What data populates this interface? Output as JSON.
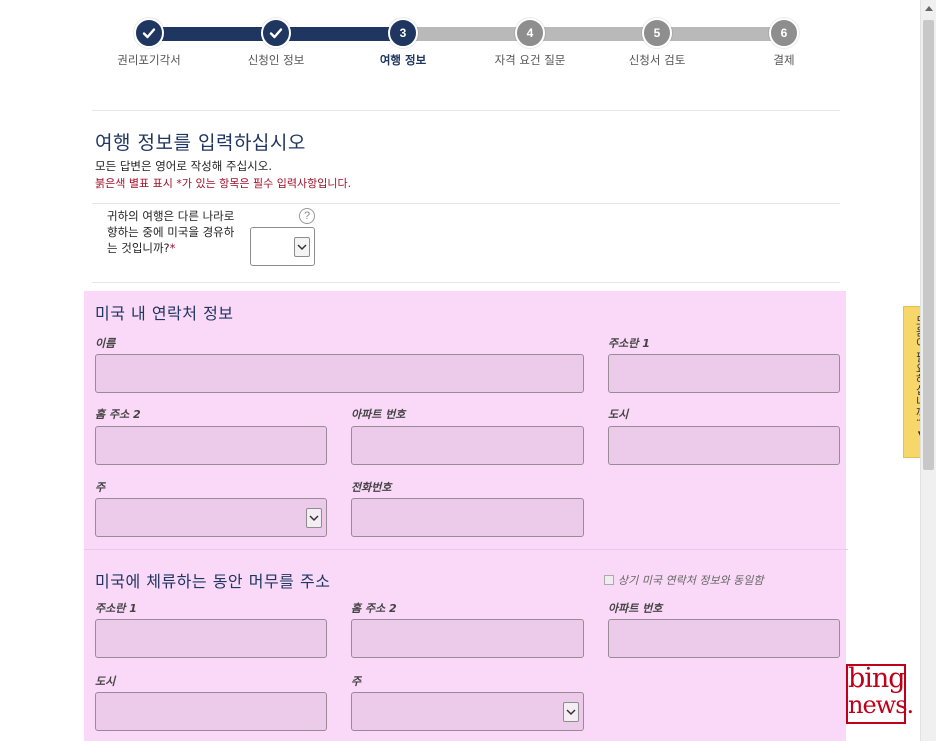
{
  "stepper": {
    "steps": [
      {
        "label": "권리포기각서",
        "number": "1",
        "state": "done"
      },
      {
        "label": "신청인 정보",
        "number": "2",
        "state": "done"
      },
      {
        "label": "여행 정보",
        "number": "3",
        "state": "current"
      },
      {
        "label": "자격 요건 질문",
        "number": "4",
        "state": "todo"
      },
      {
        "label": "신청서 검토",
        "number": "5",
        "state": "todo"
      },
      {
        "label": "결제",
        "number": "6",
        "state": "todo"
      }
    ]
  },
  "header": {
    "title": "여행 정보를 입력하십시오",
    "note": "모든 답변은 영어로 작성해 주십시오.",
    "required_note": "붉은색 별표 표시 *가 있는 항목은 필수 입력사항입니다."
  },
  "transit": {
    "question": "귀하의 여행은 다른 나라로 향하는 중에 미국을 경유하는 것입니까?",
    "required_mark": "*",
    "help_glyph": "?",
    "value": ""
  },
  "us_contact": {
    "title": "미국 내 연락처 정보",
    "name_label": "이름",
    "address1_label": "주소란 1",
    "address2_label": "홈 주소 2",
    "apt_label": "아파트 번호",
    "city_label": "도시",
    "state_label": "주",
    "phone_label": "전화번호"
  },
  "us_address": {
    "title": "미국에 체류하는 동안 머무를 주소",
    "same_as_label": "상기 미국 연락처 정보와 동일함",
    "address1_label": "주소란 1",
    "address2_label": "홈 주소 2",
    "apt_label": "아파트 번호",
    "city_label": "도시",
    "state_label": "주"
  },
  "help_tab": {
    "label": "도움이 필요하십니까? ▾"
  },
  "watermark": {
    "line1": "bing",
    "line2": "news."
  },
  "colors": {
    "navy": "#1f3661",
    "pink_panel": "#f9d9f7",
    "field": "#eccbea",
    "required_red": "#a3102a",
    "help_tab": "#f7d66a"
  }
}
